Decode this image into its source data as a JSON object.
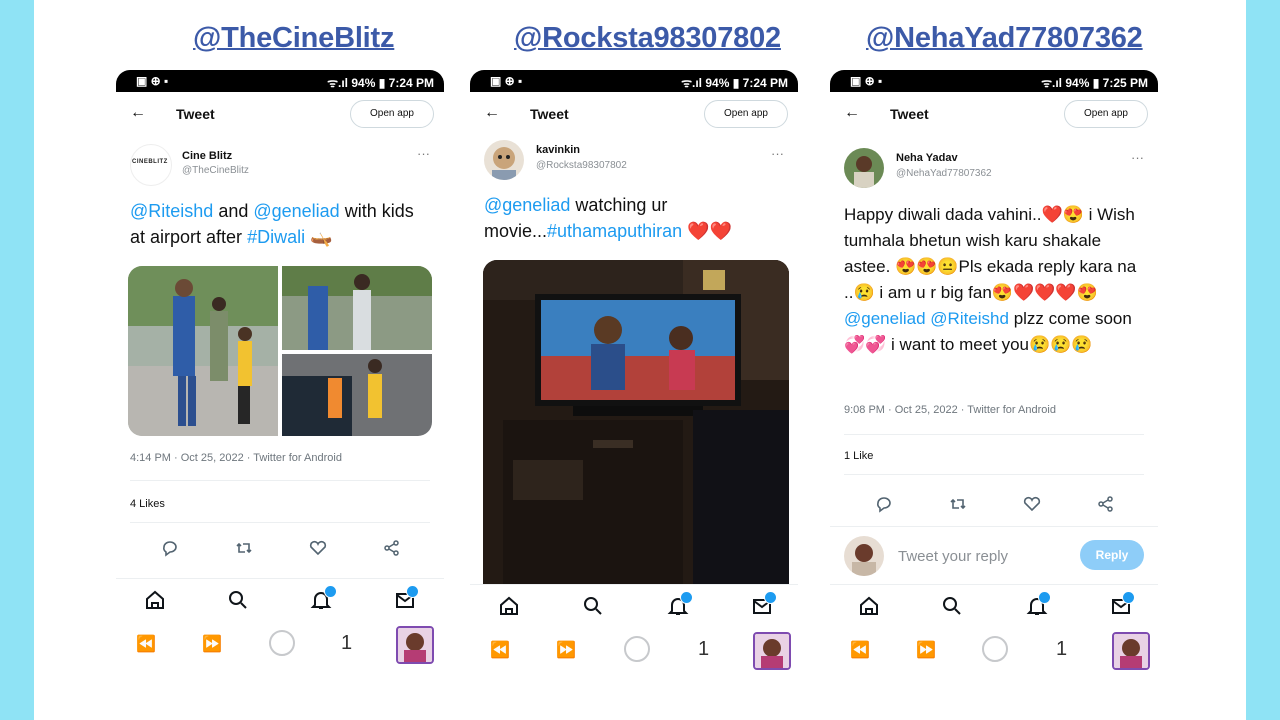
{
  "handles": [
    "@TheCineBlitz",
    "@Rocksta98307802",
    "@NehaYad77807362"
  ],
  "phones": [
    {
      "status_left": "▣ ⊕ ▪",
      "status_right": "ᯤ.ıl 94% ▮ 7:24 PM",
      "header_title": "Tweet",
      "open_app": "Open app",
      "author_name": "Cine Blitz",
      "author_handle": "@TheCineBlitz",
      "avatar_text": "CINEBLITZ",
      "tweet": {
        "m1": "@Riteishd",
        "t1": " and ",
        "m2": "@geneliad",
        "t2": " with kids at airport after ",
        "h1": "#Diwali",
        "t3": " 🛶"
      },
      "meta": "4:14 PM · Oct 25, 2022 · Twitter for Android",
      "likes": "4 Likes",
      "page_num": "1"
    },
    {
      "status_left": "▣ ⊕ ▪",
      "status_right": "ᯤ.ıl 94% ▮ 7:24 PM",
      "header_title": "Tweet",
      "open_app": "Open app",
      "author_name": "kavinkin",
      "author_handle": "@Rocksta98307802",
      "tweet": {
        "m1": "@geneliad",
        "t1": " watching ur movie...",
        "h1": "#uthamaputhiran",
        "t2": " ❤️❤️"
      },
      "page_num": "1"
    },
    {
      "status_left": "▣ ⊕ ▪",
      "status_right": "ᯤ.ıl 94% ▮ 7:25 PM",
      "header_title": "Tweet",
      "open_app": "Open app",
      "author_name": "Neha Yadav",
      "author_handle": "@NehaYad77807362",
      "tweet": {
        "t1": "Happy diwali dada vahini..❤️😍 i Wish tumhala bhetun wish karu shakale astee. 😍😍😐Pls ekada reply kara na ..😢 i am u r big fan😍❤️❤️❤️😍 ",
        "m1": "@geneliad",
        "t2": " ",
        "m2": "@Riteishd",
        "t3": "  plzz come soon 💞💞 i want to meet you😢😢😢"
      },
      "meta": "9:08 PM · Oct 25, 2022 · Twitter for Android",
      "likes": "1 Like",
      "reply_placeholder": "Tweet your reply",
      "reply_button": "Reply",
      "page_num": "1"
    }
  ],
  "colors": {
    "border_accent": "#8fe3f5",
    "handle": "#3c5aa8",
    "twitter_blue": "#1d9bf0"
  }
}
